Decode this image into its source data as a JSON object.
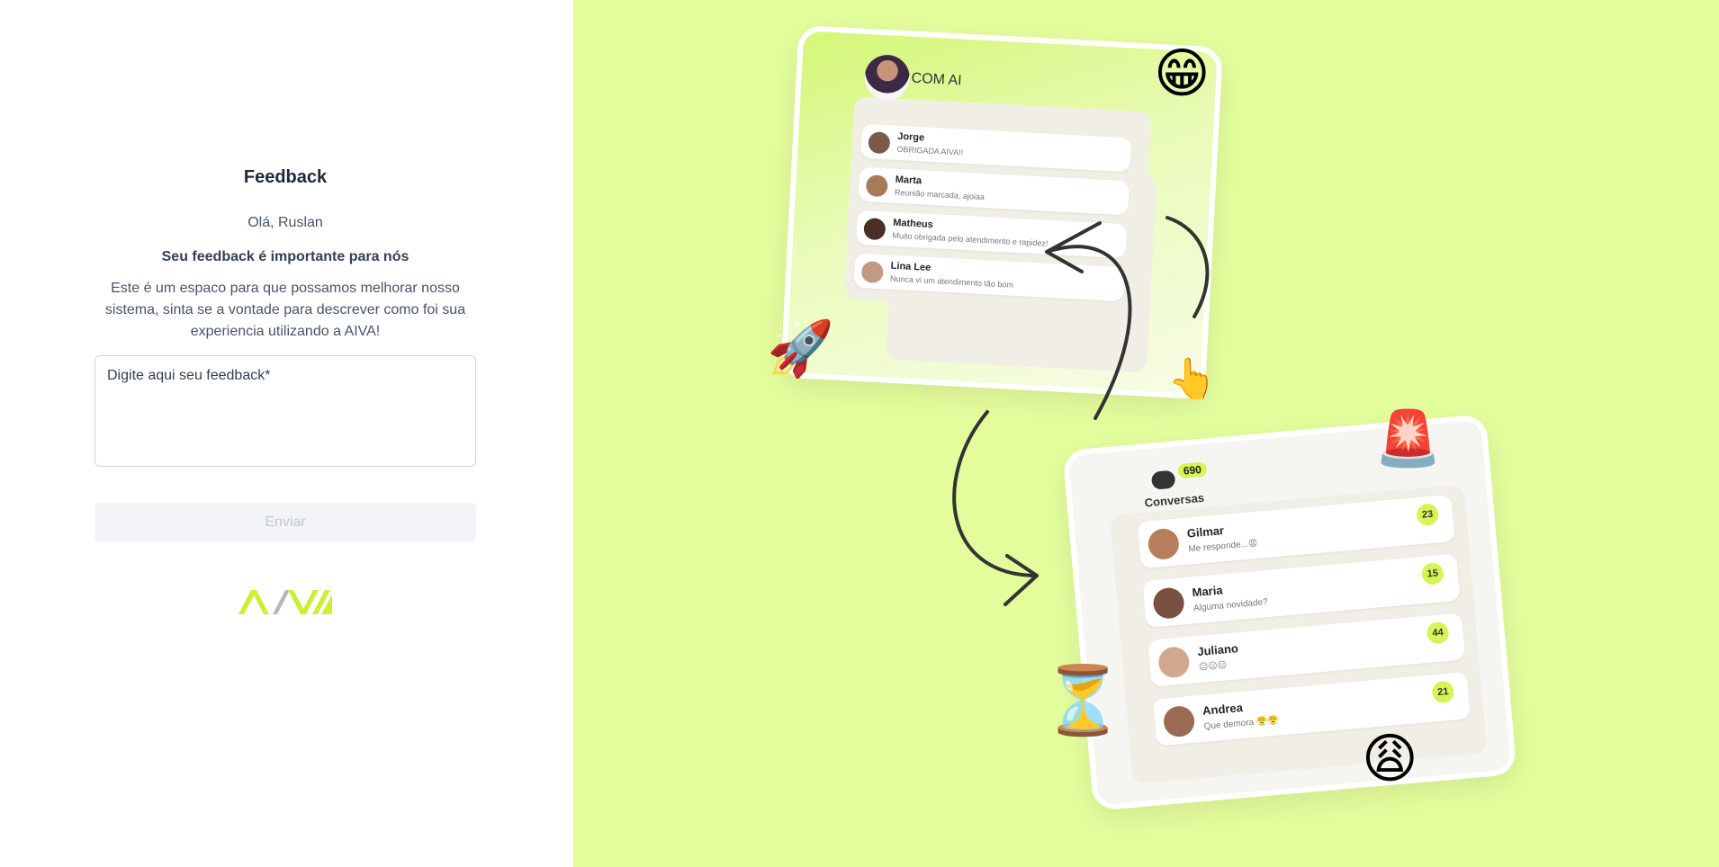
{
  "form": {
    "title": "Feedback",
    "greeting": "Olá, Ruslan",
    "subtitle": "Seu feedback é importante para nós",
    "description": "Este é um espaco para que possamos melhorar nosso sistema, sinta se a vontade para descrever como foi sua experiencia utilizando a AIVA!",
    "feedback_placeholder": "Digite aqui seu feedback*",
    "feedback_value": "",
    "submit_label": "Enviar"
  },
  "brand": {
    "logo_text": "AIVA",
    "accent_color": "#c8f035"
  },
  "illustration": {
    "background_color": "#e3fc9c",
    "card1": {
      "brand": "COM AI",
      "contacts": [
        {
          "name": "Jorge",
          "message": "OBRIGADA AIVA!!"
        },
        {
          "name": "Marta",
          "message": "Reunião marcada, ajoiaa"
        },
        {
          "name": "Matheus",
          "message": "Muito obrigada pelo atendimento e rapidez!"
        },
        {
          "name": "Lina Lee",
          "message": "Nunca vi um atendimento tão bom"
        }
      ]
    },
    "card2": {
      "count": "690",
      "label": "Conversas",
      "contacts": [
        {
          "name": "Gilmar",
          "message": "Me responde...😡",
          "badge": "23"
        },
        {
          "name": "Maria",
          "message": "Alguma novidade?",
          "badge": "15"
        },
        {
          "name": "Juliano",
          "message": "😑😑😑",
          "badge": "44"
        },
        {
          "name": "Andrea",
          "message": "Que demora 😤😤",
          "badge": "21"
        }
      ]
    },
    "emojis": [
      "grinning-face",
      "rocket",
      "hand-pointer",
      "siren",
      "hourglass",
      "weary-face"
    ]
  }
}
